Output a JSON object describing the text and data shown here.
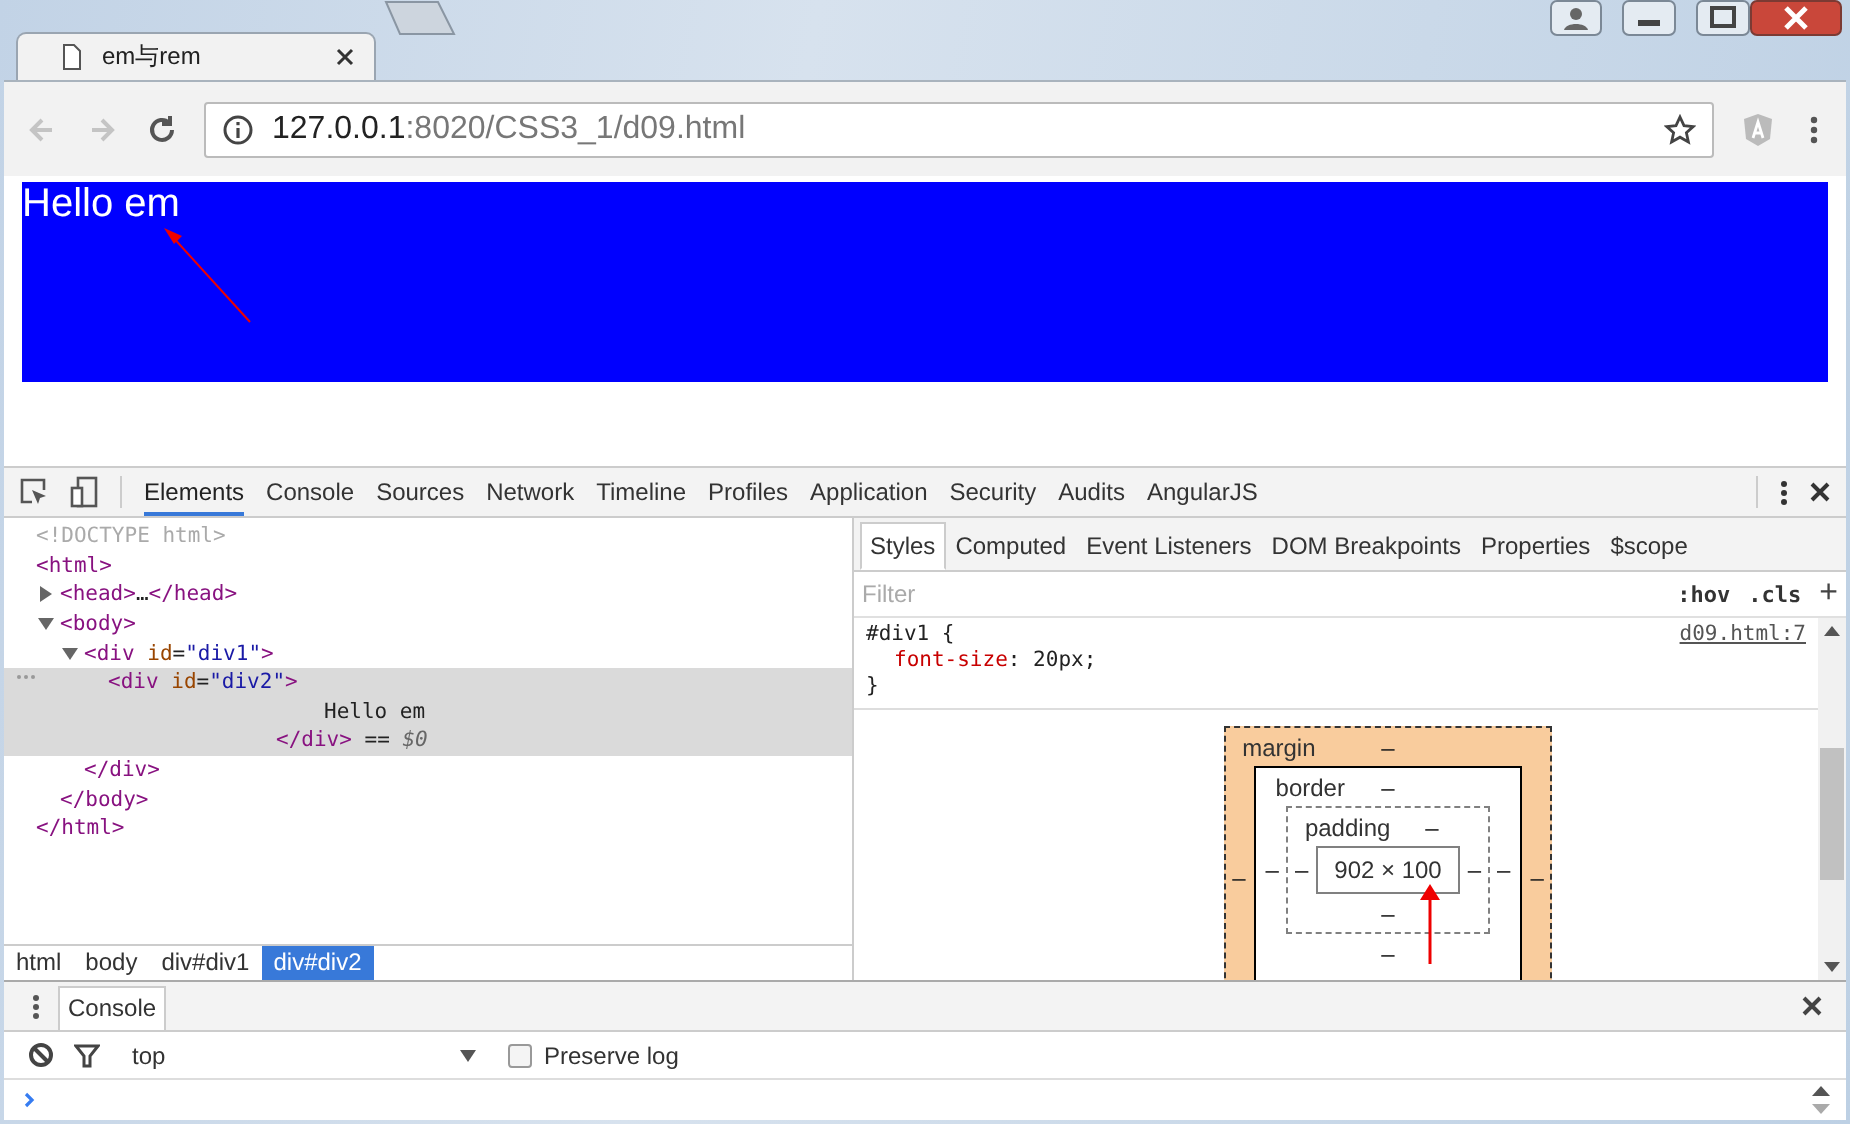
{
  "browser": {
    "tab": {
      "title": "em与rem"
    },
    "nav_buttons": [
      {
        "kind": "back",
        "disabled": true
      },
      {
        "kind": "forward",
        "disabled": true
      },
      {
        "kind": "reload",
        "disabled": false
      }
    ],
    "address": {
      "host": "127.0.0.1",
      "path": ":8020/CSS3_1/d09.html"
    }
  },
  "page": {
    "text": "Hello em"
  },
  "devtools": {
    "tabs": [
      {
        "label": "Elements",
        "selected": true
      },
      {
        "label": "Console",
        "selected": false
      },
      {
        "label": "Sources",
        "selected": false
      },
      {
        "label": "Network",
        "selected": false
      },
      {
        "label": "Timeline",
        "selected": false
      },
      {
        "label": "Profiles",
        "selected": false
      },
      {
        "label": "Application",
        "selected": false
      },
      {
        "label": "Security",
        "selected": false
      },
      {
        "label": "Audits",
        "selected": false
      },
      {
        "label": "AngularJS",
        "selected": false
      }
    ],
    "dom_tree": [
      {
        "open": [
          {
            "kind": "doctype",
            "text": "<!DOCTYPE html>"
          }
        ]
      },
      {
        "open": [
          {
            "kind": "tag",
            "text": "<html>"
          }
        ],
        "close": [
          {
            "kind": "tag",
            "text": "</html>"
          }
        ],
        "children": [
          {
            "open": [
              {
                "kind": "tag",
                "text": "<head>"
              },
              {
                "kind": "plain",
                "text": "…"
              },
              {
                "kind": "tag",
                "text": "</head>"
              }
            ],
            "expanded": false
          },
          {
            "open": [
              {
                "kind": "tag",
                "text": "<body>"
              }
            ],
            "expanded": true,
            "close": [
              {
                "kind": "tag",
                "text": "</body>"
              }
            ],
            "children": [
              {
                "open": [
                  {
                    "kind": "tag",
                    "text": "<div"
                  },
                  {
                    "kind": "attr",
                    "text": " id"
                  },
                  {
                    "kind": "plain",
                    "text": "="
                  },
                  {
                    "kind": "value",
                    "text": "\"div1\""
                  },
                  {
                    "kind": "tag",
                    "text": ">"
                  }
                ],
                "expanded": true,
                "close": [
                  {
                    "kind": "tag",
                    "text": "</div>"
                  }
                ],
                "children": [
                  {
                    "open": [
                      {
                        "kind": "tag",
                        "text": "<div"
                      },
                      {
                        "kind": "attr",
                        "text": " id"
                      },
                      {
                        "kind": "plain",
                        "text": "="
                      },
                      {
                        "kind": "value",
                        "text": "\"div2\""
                      },
                      {
                        "kind": "tag",
                        "text": ">"
                      }
                    ],
                    "selected": true,
                    "text": "Hello em",
                    "close": [
                      {
                        "kind": "tag",
                        "text": "</div>"
                      },
                      {
                        "kind": "plain",
                        "text": " == "
                      },
                      {
                        "kind": "var",
                        "text": "$0"
                      }
                    ]
                  }
                ]
              }
            ]
          }
        ]
      }
    ],
    "breadcrumbs": [
      {
        "label": "html",
        "selected": false
      },
      {
        "label": "body",
        "selected": false
      },
      {
        "label": "div#div1",
        "selected": false
      },
      {
        "label": "div#div2",
        "selected": true
      }
    ],
    "styles": {
      "tabs": [
        {
          "label": "Styles",
          "selected": true
        },
        {
          "label": "Computed",
          "selected": false
        },
        {
          "label": "Event Listeners",
          "selected": false
        },
        {
          "label": "DOM Breakpoints",
          "selected": false
        },
        {
          "label": "Properties",
          "selected": false
        },
        {
          "label": "$scope",
          "selected": false
        }
      ],
      "filter_placeholder": "Filter",
      "hov": ":hov",
      "cls": ".cls",
      "add": "+",
      "rule": {
        "selector": "#div1 {",
        "source": "d09.html:7",
        "property": "font-size",
        "value": ": 20px;",
        "close": "}"
      },
      "box_model": {
        "margin": {
          "label": "margin",
          "top": "–",
          "left": "–",
          "right": "–"
        },
        "border": {
          "label": "border",
          "top": "–",
          "left": "–",
          "right": "–",
          "bottom": "–"
        },
        "padding": {
          "label": "padding",
          "top": "–",
          "left": "–",
          "right": "–",
          "bottom": "–"
        },
        "content": "902 × 100"
      }
    }
  },
  "drawer": {
    "tabs": [
      {
        "label": "Console",
        "selected": true
      }
    ],
    "context": "top",
    "preserve_log": {
      "label": "Preserve log",
      "checked": false
    }
  }
}
